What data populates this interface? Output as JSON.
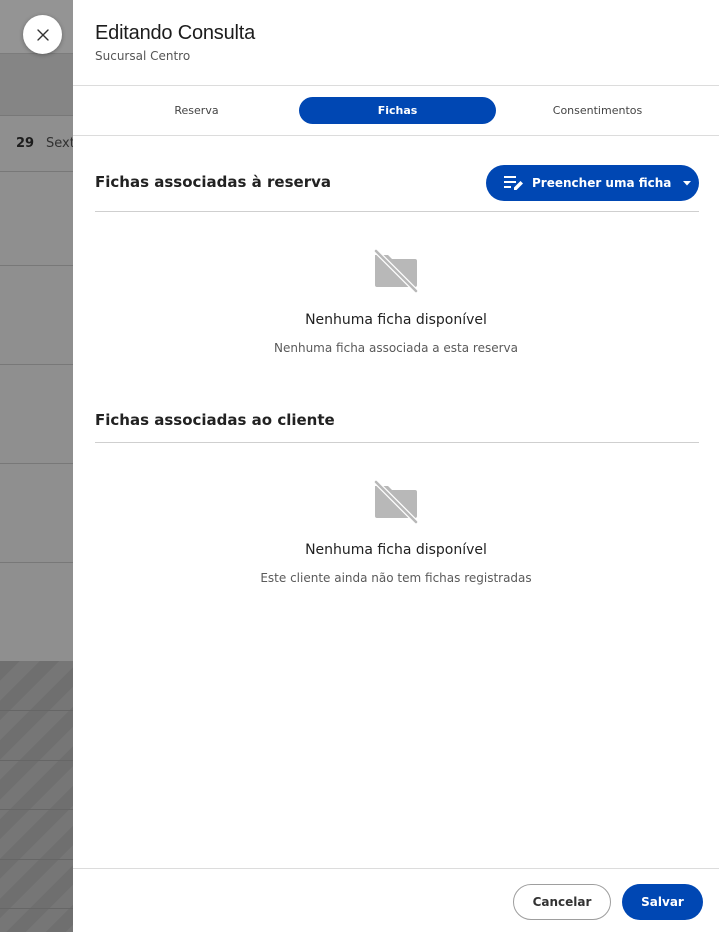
{
  "background": {
    "day_number": "29",
    "day_name": "Sexta"
  },
  "drawer": {
    "title": "Editando Consulta",
    "subtitle": "Sucursal Centro",
    "close_icon": "close-icon"
  },
  "tabs": [
    {
      "label": "Reserva",
      "active": false
    },
    {
      "label": "Fichas",
      "active": true
    },
    {
      "label": "Consentimentos",
      "active": false
    }
  ],
  "reservation_section": {
    "title": "Fichas associadas à reserva",
    "fill_button_label": "Preencher uma ficha",
    "fill_button_icon": "edit-list-icon",
    "empty_icon": "no-file-icon",
    "empty_title": "Nenhuma ficha disponível",
    "empty_description": "Nenhuma ficha associada a esta reserva"
  },
  "client_section": {
    "title": "Fichas associadas ao cliente",
    "empty_icon": "no-file-icon",
    "empty_title": "Nenhuma ficha disponível",
    "empty_description": "Este cliente ainda não tem fichas registradas"
  },
  "footer": {
    "cancel_label": "Cancelar",
    "save_label": "Salvar"
  },
  "colors": {
    "primary": "#0047b3",
    "overlay": "rgba(0,0,0,0.42)"
  }
}
